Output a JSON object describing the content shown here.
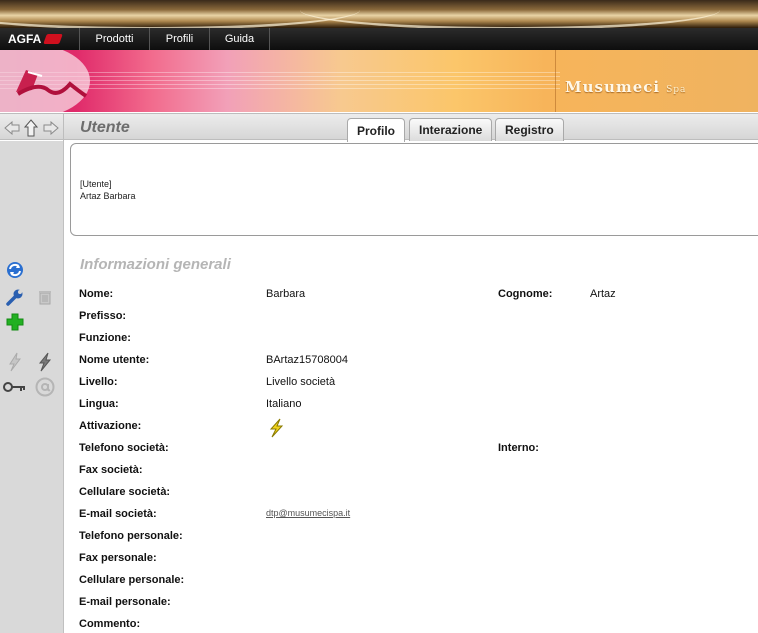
{
  "menu": {
    "logo": "AGFA",
    "logo_badge": "Agfa",
    "items": [
      {
        "label": "Prodotti"
      },
      {
        "label": "Profili"
      },
      {
        "label": "Guida"
      }
    ]
  },
  "banner": {
    "brand": "Musumeci",
    "brand_suffix": "Spa"
  },
  "titlebar": {
    "title": "Utente",
    "tabs": [
      {
        "label": "Profilo",
        "active": true
      },
      {
        "label": "Interazione",
        "active": false
      },
      {
        "label": "Registro",
        "active": false
      }
    ]
  },
  "header_box": {
    "line1": "[Utente]",
    "line2": "Artaz Barbara"
  },
  "toolbar_icons": [
    "back-arrow-icon",
    "up-arrow-icon",
    "forward-arrow-icon",
    "refresh-icon",
    "wrench-icon",
    "trash-icon",
    "add-icon",
    "disconnect-icon",
    "activate-icon",
    "key-icon",
    "email-icon"
  ],
  "section": {
    "title": "Informazioni generali",
    "fields": [
      {
        "label": "Nome:",
        "value": "Barbara"
      },
      {
        "label": "Prefisso:",
        "value": ""
      },
      {
        "label": "Funzione:",
        "value": ""
      },
      {
        "label": "Nome utente:",
        "value": "BArtaz15708004"
      },
      {
        "label": "Livello:",
        "value": "Livello società"
      },
      {
        "label": "Lingua:",
        "value": "Italiano"
      },
      {
        "label": "Attivazione:",
        "value": ""
      },
      {
        "label": "Telefono società:",
        "value": ""
      },
      {
        "label": "Fax società:",
        "value": ""
      },
      {
        "label": "Cellulare società:",
        "value": ""
      },
      {
        "label": "E-mail società:",
        "value": "dtp@musumecispa.it"
      },
      {
        "label": "Telefono personale:",
        "value": ""
      },
      {
        "label": "Fax personale:",
        "value": ""
      },
      {
        "label": "Cellulare personale:",
        "value": ""
      },
      {
        "label": "E-mail personale:",
        "value": ""
      },
      {
        "label": "Commento:",
        "value": ""
      }
    ],
    "right_fields": [
      {
        "label": "Cognome:",
        "value": "Artaz"
      },
      {
        "label": "Interno:",
        "value": ""
      }
    ]
  },
  "colors": {
    "menubar": "#111111",
    "section_title": "#b5b5b5",
    "toolbar_bg": "#d9d9d9",
    "refresh_blue": "#2a6fd0",
    "add_green": "#22b022",
    "bolt_yellow": "#f2d41b"
  }
}
